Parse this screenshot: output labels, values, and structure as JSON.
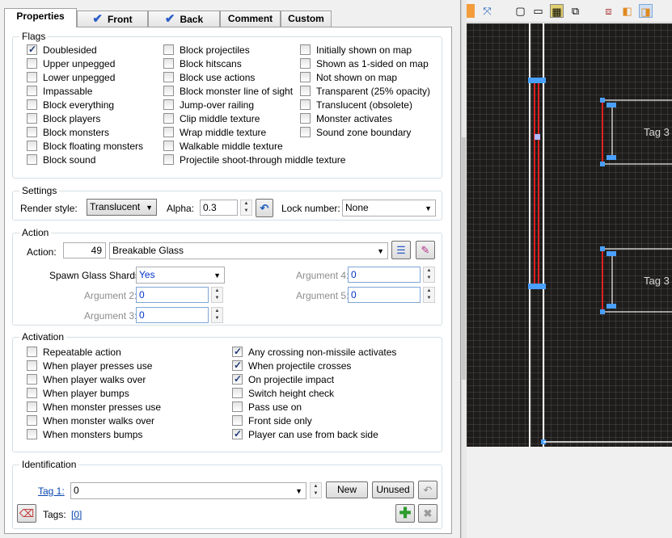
{
  "tabs": {
    "properties": "Properties",
    "front": "Front",
    "back": "Back",
    "comment": "Comment",
    "custom": "Custom"
  },
  "flags": {
    "legend": "Flags",
    "col1": [
      {
        "label": "Doublesided",
        "checked": true
      },
      {
        "label": "Upper unpegged",
        "checked": false
      },
      {
        "label": "Lower unpegged",
        "checked": false
      },
      {
        "label": "Impassable",
        "checked": false
      },
      {
        "label": "Block everything",
        "checked": false
      },
      {
        "label": "Block players",
        "checked": false
      },
      {
        "label": "Block monsters",
        "checked": false
      },
      {
        "label": "Block floating monsters",
        "checked": false
      },
      {
        "label": "Block sound",
        "checked": false
      }
    ],
    "col2": [
      {
        "label": "Block projectiles",
        "checked": false
      },
      {
        "label": "Block hitscans",
        "checked": false
      },
      {
        "label": "Block use actions",
        "checked": false
      },
      {
        "label": "Block monster line of sight",
        "checked": false
      },
      {
        "label": "Jump-over railing",
        "checked": false
      },
      {
        "label": "Clip middle texture",
        "checked": false
      },
      {
        "label": "Wrap middle texture",
        "checked": false
      },
      {
        "label": "Walkable middle texture",
        "checked": false
      },
      {
        "label": "Projectile shoot-through middle texture",
        "checked": false
      }
    ],
    "col3": [
      {
        "label": "Initially shown on map",
        "checked": false
      },
      {
        "label": "Shown as 1-sided on map",
        "checked": false
      },
      {
        "label": "Not shown on map",
        "checked": false
      },
      {
        "label": "Transparent (25% opacity)",
        "checked": false
      },
      {
        "label": "Translucent (obsolete)",
        "checked": false
      },
      {
        "label": "Monster activates",
        "checked": false
      },
      {
        "label": "Sound zone boundary",
        "checked": false
      }
    ]
  },
  "settings": {
    "legend": "Settings",
    "render_style_label": "Render style:",
    "render_style": "Translucent",
    "alpha_label": "Alpha:",
    "alpha": "0.3",
    "lock_label": "Lock number:",
    "lock": "None"
  },
  "action": {
    "legend": "Action",
    "action_label": "Action:",
    "number": "49",
    "name": "Breakable Glass",
    "spawn_label": "Spawn Glass Shards:",
    "spawn": "Yes",
    "arg2_label": "Argument 2:",
    "arg2": "0",
    "arg3_label": "Argument 3:",
    "arg3": "0",
    "arg4_label": "Argument 4:",
    "arg4": "0",
    "arg5_label": "Argument 5:",
    "arg5": "0"
  },
  "activation": {
    "legend": "Activation",
    "col1": [
      {
        "label": "Repeatable action",
        "checked": false
      },
      {
        "label": "When player presses use",
        "checked": false
      },
      {
        "label": "When player walks over",
        "checked": false
      },
      {
        "label": "When player bumps",
        "checked": false
      },
      {
        "label": "When monster presses use",
        "checked": false
      },
      {
        "label": "When monster walks over",
        "checked": false
      },
      {
        "label": "When monsters bumps",
        "checked": false
      }
    ],
    "col2": [
      {
        "label": "Any crossing non-missile activates",
        "checked": true
      },
      {
        "label": "When projectile crosses",
        "checked": true
      },
      {
        "label": "On projectile impact",
        "checked": true
      },
      {
        "label": "Switch height check",
        "checked": false
      },
      {
        "label": "Pass use on",
        "checked": false
      },
      {
        "label": "Front side only",
        "checked": false
      },
      {
        "label": "Player can use from back side",
        "checked": true
      }
    ]
  },
  "identification": {
    "legend": "Identification",
    "tag_label": "Tag 1:",
    "tag": "0",
    "new_button": "New",
    "unused_button": "Unused",
    "tags_label": "Tags:",
    "tags_link": "[0]"
  },
  "map": {
    "tag_label_1": "Tag 3",
    "tag_label_2": "Tag 3"
  }
}
